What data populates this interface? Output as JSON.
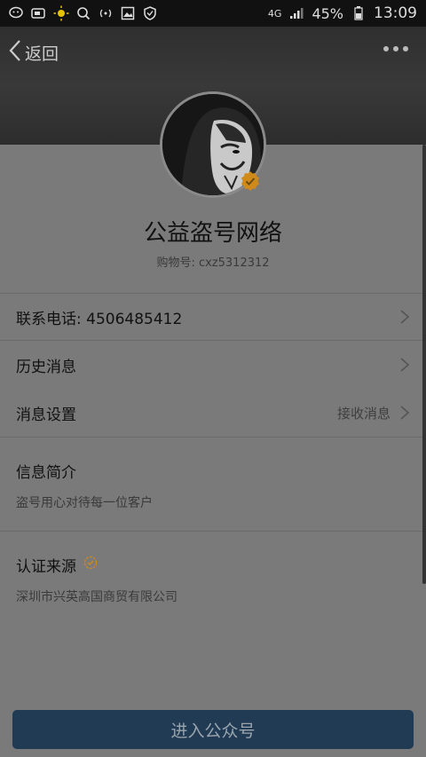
{
  "status_bar": {
    "network": "4G",
    "battery": "45%",
    "time": "13:09",
    "left_icons": [
      "wechat-icon",
      "battery-saver-icon",
      "brightness-icon",
      "search-icon",
      "hotspot-icon",
      "gallery-icon",
      "shield-icon"
    ]
  },
  "header": {
    "back_label": "返回",
    "more_icon": "more-icon"
  },
  "profile": {
    "name": "公益盗号网络",
    "account": "购物号: cxz5312312"
  },
  "rows": {
    "phone_label": "联系电话: 4506485412",
    "history_label": "历史消息",
    "settings_label": "消息设置",
    "settings_value": "接收消息"
  },
  "intro": {
    "title": "信息简介",
    "text": "盗号用心对待每一位客户"
  },
  "certification": {
    "title": "认证来源",
    "text": "深圳市兴英高国商贸有限公司"
  },
  "footer": {
    "enter_label": "进入公众号"
  },
  "colors": {
    "background": "#7a7a7a",
    "header": "#333333",
    "button": "#213b55",
    "badge": "#d08a1a"
  }
}
